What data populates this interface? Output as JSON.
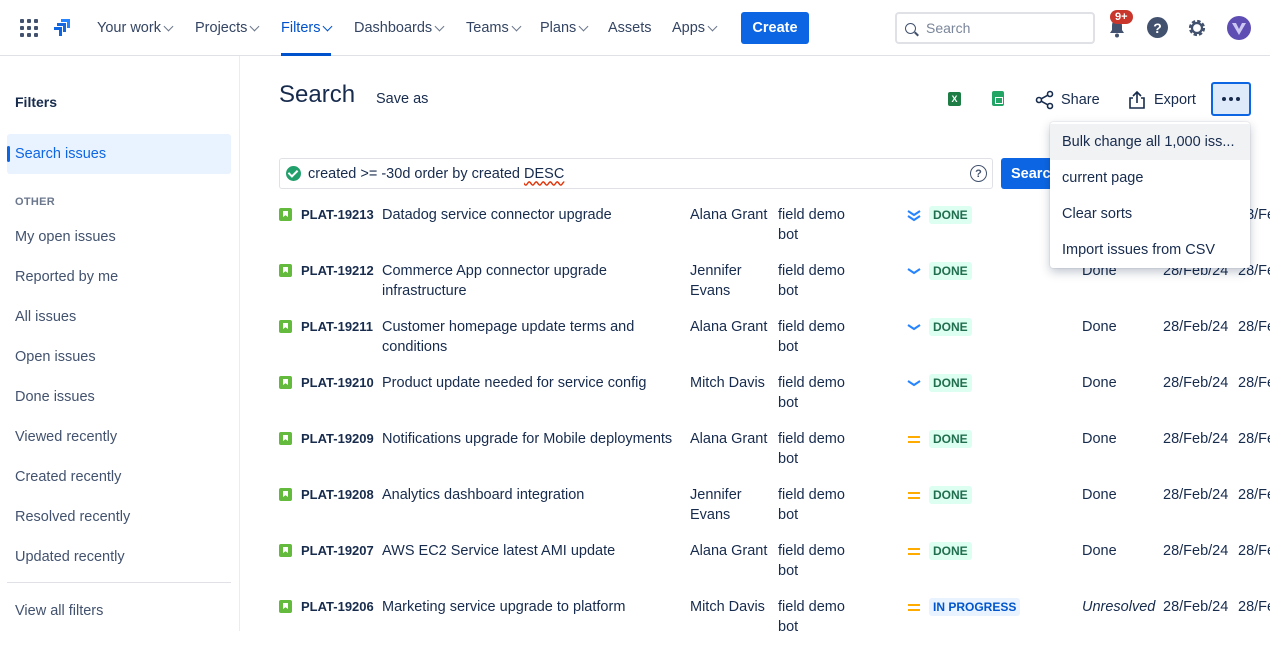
{
  "nav": {
    "items": [
      "Your work",
      "Projects",
      "Filters",
      "Dashboards",
      "Teams",
      "Plans",
      "Assets",
      "Apps"
    ],
    "create_label": "Create",
    "search_placeholder": "Search",
    "notifications_badge": "9+"
  },
  "sidebar": {
    "title": "Filters",
    "active_item": "Search issues",
    "section_label": "OTHER",
    "items": [
      "My open issues",
      "Reported by me",
      "All issues",
      "Open issues",
      "Done issues",
      "Viewed recently",
      "Created recently",
      "Resolved recently",
      "Updated recently"
    ],
    "footer_item": "View all filters"
  },
  "header": {
    "title": "Search",
    "save_as": "Save as",
    "share": "Share",
    "export": "Export"
  },
  "query": {
    "jql_prefix": "created >= -30d order by created ",
    "jql_suffix": "DESC",
    "search_button": "Search"
  },
  "issues": [
    {
      "key": "PLAT-19213",
      "summary": "Datadog service connector upgrade",
      "assignee": "Alana Grant",
      "reporter": "field demo bot",
      "priority": "lowest",
      "status": "DONE",
      "resolution": "",
      "created": "",
      "updated": "28/Fe"
    },
    {
      "key": "PLAT-19212",
      "summary": "Commerce App connector upgrade infrastructure",
      "assignee": "Jennifer Evans",
      "reporter": "field demo bot",
      "priority": "low",
      "status": "DONE",
      "resolution": "Done",
      "created": "28/Feb/24",
      "updated": "28/Fe"
    },
    {
      "key": "PLAT-19211",
      "summary": "Customer homepage update terms and conditions",
      "assignee": "Alana Grant",
      "reporter": "field demo bot",
      "priority": "low",
      "status": "DONE",
      "resolution": "Done",
      "created": "28/Feb/24",
      "updated": "28/Fe"
    },
    {
      "key": "PLAT-19210",
      "summary": "Product update needed for service config",
      "assignee": "Mitch Davis",
      "reporter": "field demo bot",
      "priority": "low",
      "status": "DONE",
      "resolution": "Done",
      "created": "28/Feb/24",
      "updated": "28/Fe"
    },
    {
      "key": "PLAT-19209",
      "summary": "Notifications upgrade for Mobile deployments",
      "assignee": "Alana Grant",
      "reporter": "field demo bot",
      "priority": "medium",
      "status": "DONE",
      "resolution": "Done",
      "created": "28/Feb/24",
      "updated": "28/Fe"
    },
    {
      "key": "PLAT-19208",
      "summary": "Analytics dashboard integration",
      "assignee": "Jennifer Evans",
      "reporter": "field demo bot",
      "priority": "medium",
      "status": "DONE",
      "resolution": "Done",
      "created": "28/Feb/24",
      "updated": "28/Fe"
    },
    {
      "key": "PLAT-19207",
      "summary": "AWS EC2 Service latest AMI update",
      "assignee": "Alana Grant",
      "reporter": "field demo bot",
      "priority": "medium",
      "status": "DONE",
      "resolution": "Done",
      "created": "28/Feb/24",
      "updated": "28/Fe"
    },
    {
      "key": "PLAT-19206",
      "summary": "Marketing service upgrade to platform",
      "assignee": "Mitch Davis",
      "reporter": "field demo bot",
      "priority": "medium",
      "status": "IN PROGRESS",
      "resolution": "Unresolved",
      "created": "28/Feb/24",
      "updated": "28/Fe"
    }
  ],
  "more_menu": {
    "items": [
      "Bulk change all 1,000 iss...",
      "current page",
      "Clear sorts",
      "Import issues from CSV"
    ]
  },
  "colors": {
    "accent": "#0c66e4",
    "done_bg": "#dcfff1",
    "done_fg": "#216e4e",
    "progress_bg": "#e9f2ff",
    "progress_fg": "#0055cc",
    "priority_low": "#2684ff",
    "priority_medium": "#ffab00"
  }
}
